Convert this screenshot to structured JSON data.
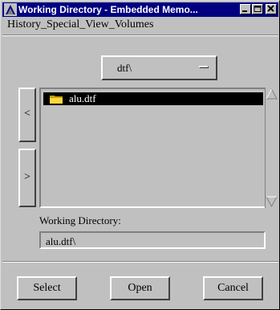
{
  "window": {
    "title": "Working Directory - Embedded Memo...",
    "controls": [
      "minimize-icon",
      "maximize-icon",
      "close-icon"
    ]
  },
  "menu": {
    "items": [
      "History",
      "_Special",
      "_View",
      "_Volumes"
    ]
  },
  "volume_dropdown": {
    "selected": "dtf\\"
  },
  "nav": {
    "back_label": "<",
    "forward_label": ">"
  },
  "file_list": {
    "items": [
      {
        "label": "alu.dtf",
        "icon": "folder-icon",
        "selected": true
      }
    ]
  },
  "working_directory": {
    "label": "Working Directory:",
    "value": "alu.dtf\\"
  },
  "buttons": {
    "select": "Select",
    "open": "Open",
    "cancel": "Cancel"
  },
  "colors": {
    "titlebar": "#000080",
    "face": "#c0c0c0",
    "selection": "#000000"
  }
}
